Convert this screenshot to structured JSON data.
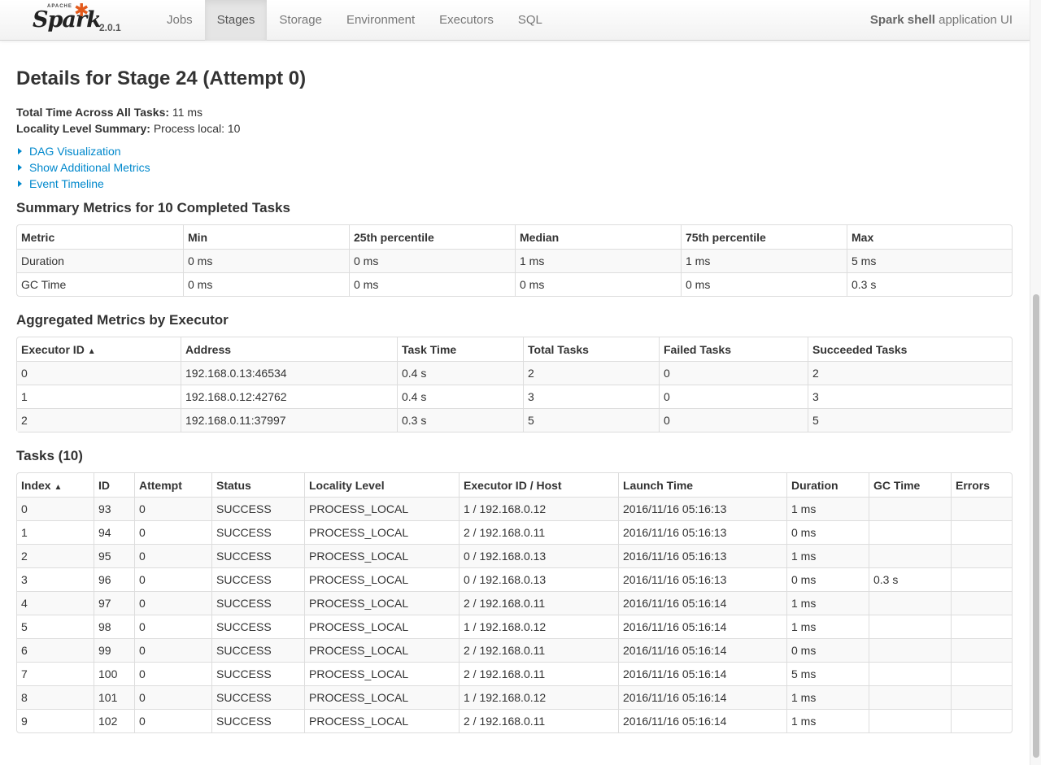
{
  "navbar": {
    "brand": {
      "apache": "APACHE",
      "spark": "Spark",
      "version": "2.0.1"
    },
    "tabs": [
      {
        "label": "Jobs",
        "active": false
      },
      {
        "label": "Stages",
        "active": true
      },
      {
        "label": "Storage",
        "active": false
      },
      {
        "label": "Environment",
        "active": false
      },
      {
        "label": "Executors",
        "active": false
      },
      {
        "label": "SQL",
        "active": false
      }
    ],
    "app_name": "Spark shell",
    "app_suffix": " application UI"
  },
  "page": {
    "title": "Details for Stage 24 (Attempt 0)",
    "total_time_label": "Total Time Across All Tasks:",
    "total_time_value": " 11 ms",
    "locality_label": "Locality Level Summary:",
    "locality_value": " Process local: 10",
    "expanders": [
      "DAG Visualization",
      "Show Additional Metrics",
      "Event Timeline"
    ]
  },
  "summary_metrics": {
    "title": "Summary Metrics for 10 Completed Tasks",
    "headers": [
      "Metric",
      "Min",
      "25th percentile",
      "Median",
      "75th percentile",
      "Max"
    ],
    "rows": [
      [
        "Duration",
        "0 ms",
        "0 ms",
        "1 ms",
        "1 ms",
        "5 ms"
      ],
      [
        "GC Time",
        "0 ms",
        "0 ms",
        "0 ms",
        "0 ms",
        "0.3 s"
      ]
    ]
  },
  "executor_metrics": {
    "title": "Aggregated Metrics by Executor",
    "headers": [
      "Executor ID",
      "Address",
      "Task Time",
      "Total Tasks",
      "Failed Tasks",
      "Succeeded Tasks"
    ],
    "sort_indicator": "▲",
    "rows": [
      [
        "0",
        "192.168.0.13:46534",
        "0.4 s",
        "2",
        "0",
        "2"
      ],
      [
        "1",
        "192.168.0.12:42762",
        "0.4 s",
        "3",
        "0",
        "3"
      ],
      [
        "2",
        "192.168.0.11:37997",
        "0.3 s",
        "5",
        "0",
        "5"
      ]
    ]
  },
  "tasks": {
    "title": "Tasks (10)",
    "headers": [
      "Index",
      "ID",
      "Attempt",
      "Status",
      "Locality Level",
      "Executor ID / Host",
      "Launch Time",
      "Duration",
      "GC Time",
      "Errors"
    ],
    "sort_indicator": "▲",
    "rows": [
      [
        "0",
        "93",
        "0",
        "SUCCESS",
        "PROCESS_LOCAL",
        "1 / 192.168.0.12",
        "2016/11/16 05:16:13",
        "1 ms",
        "",
        ""
      ],
      [
        "1",
        "94",
        "0",
        "SUCCESS",
        "PROCESS_LOCAL",
        "2 / 192.168.0.11",
        "2016/11/16 05:16:13",
        "0 ms",
        "",
        ""
      ],
      [
        "2",
        "95",
        "0",
        "SUCCESS",
        "PROCESS_LOCAL",
        "0 / 192.168.0.13",
        "2016/11/16 05:16:13",
        "1 ms",
        "",
        ""
      ],
      [
        "3",
        "96",
        "0",
        "SUCCESS",
        "PROCESS_LOCAL",
        "0 / 192.168.0.13",
        "2016/11/16 05:16:13",
        "0 ms",
        "0.3 s",
        ""
      ],
      [
        "4",
        "97",
        "0",
        "SUCCESS",
        "PROCESS_LOCAL",
        "2 / 192.168.0.11",
        "2016/11/16 05:16:14",
        "1 ms",
        "",
        ""
      ],
      [
        "5",
        "98",
        "0",
        "SUCCESS",
        "PROCESS_LOCAL",
        "1 / 192.168.0.12",
        "2016/11/16 05:16:14",
        "1 ms",
        "",
        ""
      ],
      [
        "6",
        "99",
        "0",
        "SUCCESS",
        "PROCESS_LOCAL",
        "2 / 192.168.0.11",
        "2016/11/16 05:16:14",
        "0 ms",
        "",
        ""
      ],
      [
        "7",
        "100",
        "0",
        "SUCCESS",
        "PROCESS_LOCAL",
        "2 / 192.168.0.11",
        "2016/11/16 05:16:14",
        "5 ms",
        "",
        ""
      ],
      [
        "8",
        "101",
        "0",
        "SUCCESS",
        "PROCESS_LOCAL",
        "1 / 192.168.0.12",
        "2016/11/16 05:16:14",
        "1 ms",
        "",
        ""
      ],
      [
        "9",
        "102",
        "0",
        "SUCCESS",
        "PROCESS_LOCAL",
        "2 / 192.168.0.11",
        "2016/11/16 05:16:14",
        "1 ms",
        "",
        ""
      ]
    ]
  },
  "colors": {
    "link": "#0088cc",
    "brand_star": "#e25a1c"
  }
}
